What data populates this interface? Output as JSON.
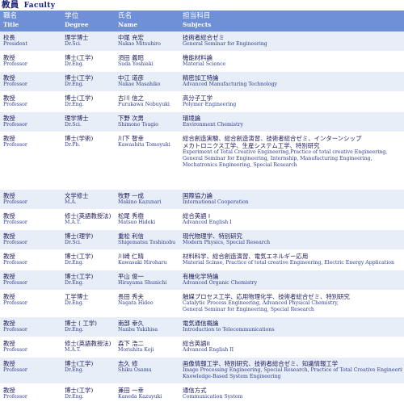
{
  "title": {
    "jp": "教員",
    "en": "Faculty"
  },
  "header": {
    "title_jp": "職名",
    "title_en": "Title",
    "degree_jp": "学位",
    "degree_en": "Degree",
    "name_jp": "氏名",
    "name_en": "Name",
    "subjects_jp": "担当科目",
    "subjects_en": "Subjects"
  },
  "rows": [
    {
      "title_jp": "校長",
      "title_en": "President",
      "degree_jp": "理学博士",
      "degree_en": "Dr.Sci.",
      "name_jp": "中尾 充宏",
      "name_en": "Nakao Mitsuhiro",
      "subjects_jp": [
        "技術者総合ゼミ"
      ],
      "subjects_en": [
        "General Seminar for Engineering"
      ]
    },
    {
      "title_jp": "教授",
      "title_en": "Professor",
      "degree_jp": "博士(工学)",
      "degree_en": "Dr.Eng.",
      "name_jp": "須田 義昭",
      "name_en": "Suda Yoshiaki",
      "subjects_jp": [
        "機能材料論"
      ],
      "subjects_en": [
        "Material Science"
      ]
    },
    {
      "title_jp": "教授",
      "title_en": "Professor",
      "degree_jp": "博士(工学)",
      "degree_en": "Dr.Eng.",
      "name_jp": "中江 道彦",
      "name_en": "Nakae Masahiko",
      "subjects_jp": [
        "精密加工特論"
      ],
      "subjects_en": [
        "Advanced Manufacturing Technology"
      ]
    },
    {
      "title_jp": "教授",
      "title_en": "Professor",
      "degree_jp": "博士(工学)",
      "degree_en": "Dr.Eng.",
      "name_jp": "古川 信之",
      "name_en": "Furukawa Nobuyuki",
      "subjects_jp": [
        "高分子工学"
      ],
      "subjects_en": [
        "Polymer Engineering"
      ]
    },
    {
      "title_jp": "教授",
      "title_en": "Professor",
      "degree_jp": "理学博士",
      "degree_en": "Dr.Sci.",
      "name_jp": "下野 次男",
      "name_en": "Shimono Tsugio",
      "subjects_jp": [
        "環境論"
      ],
      "subjects_en": [
        "Environment Chemistry"
      ]
    },
    {
      "title_jp": "教授",
      "title_en": "Professor",
      "degree_jp": "博士(学術)",
      "degree_en": "Dr.Ph.",
      "name_jp": "川下 智幸",
      "name_en": "Kawashita Tomoyuki",
      "subjects_jp": [
        "総合創造実験、総合創造演習、技術者総合ゼミ、インターンシップ",
        "メカトロニクス工学、生産システム工学、特別研究"
      ],
      "subjects_en": [
        "Experiment of Total Creative Engineering,Practice of total creative Engineering,",
        "General Seminar for Engineering, Internship, Manufacturing Engineering,",
        "Mechatronics Engineering, Special Research"
      ]
    },
    {
      "title_jp": "教授",
      "title_en": "Professor",
      "degree_jp": "文学修士",
      "degree_en": "M.A.",
      "name_jp": "牧野 一成",
      "name_en": "Makino Kazunari",
      "subjects_jp": [
        "国際協力論"
      ],
      "subjects_en": [
        "International Cooperation"
      ]
    },
    {
      "title_jp": "教授",
      "title_en": "Professor",
      "degree_jp": "修士(英語教授法)",
      "degree_en": "M.A.T.",
      "name_jp": "松尾 秀樹",
      "name_en": "Matsuo Hideki",
      "subjects_jp": [
        "総合英語 I"
      ],
      "subjects_en": [
        "Advanced English I"
      ]
    },
    {
      "title_jp": "教授",
      "title_en": "Professor",
      "degree_jp": "博士(理学)",
      "degree_en": "Dr.Sci.",
      "name_jp": "重松 利信",
      "name_en": "Shigematsu Toshinobu",
      "subjects_jp": [
        "現代物理学、特別研究"
      ],
      "subjects_en": [
        "Modern Physics, Special Research"
      ]
    },
    {
      "title_jp": "教授",
      "title_en": "Professor",
      "degree_jp": "博士(工学)",
      "degree_en": "Dr.Eng.",
      "name_jp": "川崎 仁晴",
      "name_en": "Kawasaki Hiroharu",
      "subjects_jp": [
        "材料科学、総合創造演習、電気エネルギー応用"
      ],
      "subjects_en": [
        "Material Scinse, Practice of total creative Engineering, Electric Energy Application"
      ]
    },
    {
      "title_jp": "教授",
      "title_en": "Professor",
      "degree_jp": "博士(工学)",
      "degree_en": "Dr.Eng.",
      "name_jp": "平山 俊一",
      "name_en": "Hirayama Shunichi",
      "subjects_jp": [
        "有機化学特論"
      ],
      "subjects_en": [
        "Advanced Organic Chemistry"
      ]
    },
    {
      "title_jp": "教授",
      "title_en": "Professor",
      "degree_jp": "工学博士",
      "degree_en": "Dr.Eng.",
      "name_jp": "長田 秀夫",
      "name_en": "Nagata Hideo",
      "subjects_jp": [
        "触媒プロセス工学、応用物理化学、技術者総合ゼミ、特別研究"
      ],
      "subjects_en": [
        "Catalytic Process Engineering, Advanced Physical Chemistry,",
        "General Seminar for Engineering, Special Research"
      ]
    },
    {
      "title_jp": "教授",
      "title_en": "Professor",
      "degree_jp": "博士 ( 工学)",
      "degree_en": "Dr.Eng.",
      "name_jp": "南部 幸久",
      "name_en": "Nanbu Yukihisa",
      "subjects_jp": [
        "電気通信概論"
      ],
      "subjects_en": [
        "Introduction to Telecommunications"
      ]
    },
    {
      "title_jp": "教授",
      "title_en": "Professor",
      "degree_jp": "修士(英語教授法)",
      "degree_en": "M.A.T.",
      "name_jp": "森下 浩二",
      "name_en": "Morishita Koji",
      "subjects_jp": [
        "総合英語II"
      ],
      "subjects_en": [
        "Advanced English II"
      ]
    },
    {
      "title_jp": "教授",
      "title_en": "Professor",
      "degree_jp": "博士(工学)",
      "degree_en": "Dr.Eng.",
      "name_jp": "志久 修",
      "name_en": "Shiku Osamu",
      "subjects_jp": [
        "画像情報工学、特別研究、技術者総合ゼミ、知識情報工学"
      ],
      "subjects_en": [
        "Image Processing Engineering, Special Research, Practice of Total Creative Engineering,",
        "Knowledge-Based System Engineering"
      ]
    },
    {
      "title_jp": "教授",
      "title_en": "Professor",
      "degree_jp": "博士(工学)",
      "degree_en": "Dr.Eng.",
      "name_jp": "兼田 一幸",
      "name_en": "Kaneda Kazuyuki",
      "subjects_jp": [
        "通信方式"
      ],
      "subjects_en": [
        "Communication System"
      ]
    }
  ]
}
